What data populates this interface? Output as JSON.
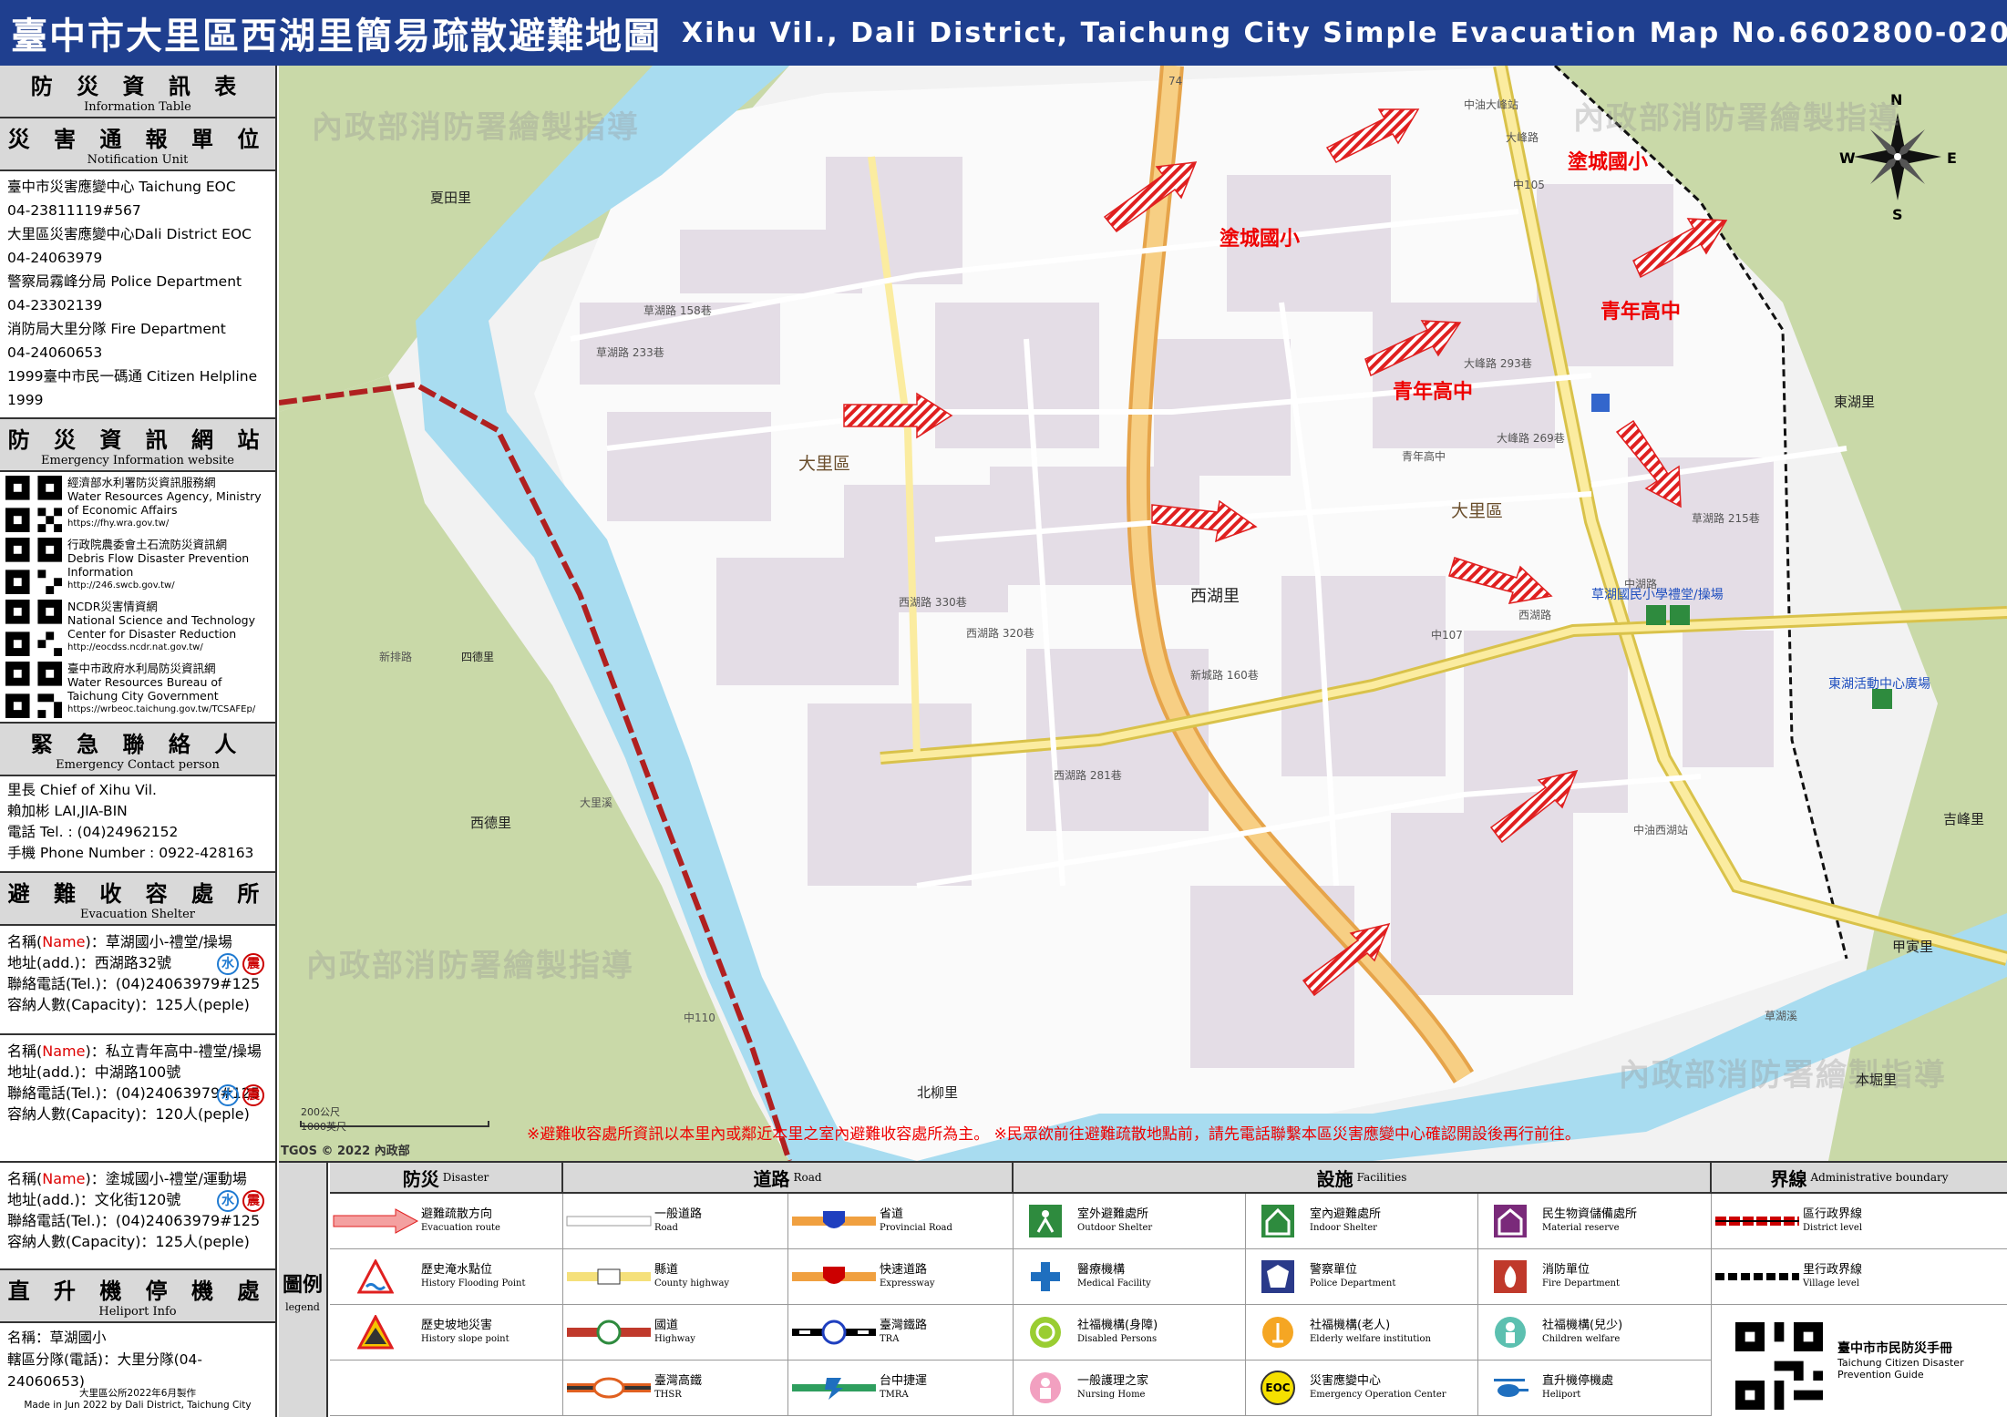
{
  "title": {
    "zh": "臺中市大里區西湖里簡易疏散避難地圖",
    "en": "Xihu Vil., Dali District, Taichung City Simple Evacuation Map No.6602800-020"
  },
  "info_table": {
    "zh": "防 災 資 訊 表",
    "en": "Information Table"
  },
  "notification": {
    "zh": "災 害 通 報 單 位",
    "en": "Notification Unit",
    "lines": [
      "臺中市災害應變中心 Taichung EOC",
      "04-23811119#567",
      "大里區災害應變中心Dali District EOC",
      "04-24063979",
      "警察局霧峰分局 Police Department",
      "04-23302139",
      "消防局大里分隊 Fire Department",
      "04-24060653",
      "1999臺中市民一碼通 Citizen Helpline",
      "1999"
    ]
  },
  "websites": {
    "zh": "防 災 資 訊 網 站",
    "en": "Emergency Information website",
    "items": [
      {
        "zh": "經濟部水利署防災資訊服務網",
        "en": "Water Resources Agency, Ministry of Economic Affairs",
        "url": "https://fhy.wra.gov.tw/"
      },
      {
        "zh": "行政院農委會土石流防災資訊網",
        "en": "Debris Flow Disaster Prevention Information",
        "url": "http://246.swcb.gov.tw/"
      },
      {
        "zh": "NCDR災害情資網",
        "en": "National Science and Technology Center for Disaster Reduction",
        "url": "http://eocdss.ncdr.nat.gov.tw/"
      },
      {
        "zh": "臺中市政府水利局防災資訊網",
        "en": "Water Resources Bureau of Taichung City Government",
        "url": "https://wrbeoc.taichung.gov.tw/TCSAFEp/"
      }
    ]
  },
  "contact": {
    "zh": "緊 急 聯 絡 人",
    "en": "Emergency Contact person",
    "lines": [
      "里長 Chief of Xihu Vil.",
      "賴加彬 LAI,JIA-BIN",
      "電話 Tel. : (04)24962152",
      "手機 Phone Number : 0922-428163"
    ]
  },
  "shelter": {
    "zh": "避 難 收 容 處 所",
    "en": "Evacuation Shelter",
    "name_prefix": "名稱(",
    "name_word": "Name",
    "name_suffix": ")：",
    "water_badge": "水",
    "quake_badge": "震",
    "items": [
      {
        "name": "草湖國小-禮堂/操場",
        "addr": "地址(add.)：西湖路32號",
        "tel": "聯絡電話(Tel.)：(04)24063979#125",
        "cap": "容納人數(Capacity)：125人(peple)"
      },
      {
        "name": "私立青年高中-禮堂/操場",
        "addr": "地址(add.)：中湖路100號",
        "tel": "聯絡電話(Tel.)：(04)24063979#125",
        "cap": "容納人數(Capacity)：120人(peple)"
      },
      {
        "name": "塗城國小-禮堂/運動場",
        "addr": "地址(add.)：文化街120號",
        "tel": "聯絡電話(Tel.)：(04)24063979#125",
        "cap": "容納人數(Capacity)：125人(peple)"
      }
    ]
  },
  "heliport": {
    "zh": "直 升 機 停 機 處",
    "en": "Heliport Info",
    "lines": [
      "名稱：草湖國小",
      "轄區分隊(電話)：大里分隊(04-24060653)"
    ]
  },
  "footer": {
    "zh": "大里區公所2022年6月製作",
    "en": "Made in Jun 2022 by Dali District, Taichung City"
  },
  "map": {
    "shelter_labels": [
      {
        "text": "塗城國小"
      },
      {
        "text": "塗城國小"
      },
      {
        "text": "青年高中"
      },
      {
        "text": "青年高中"
      }
    ],
    "area_labels": [
      "大里區",
      "大里區",
      "西湖里",
      "東湖里",
      "夏田里",
      "西德里",
      "四德里",
      "甲寅里",
      "北柳里",
      "本堀里",
      "吉峰里"
    ],
    "place_labels": [
      "草湖國民小學禮堂/操場",
      "東湖活動中心廣場"
    ],
    "watermark": "內政部消防署繪製指導",
    "road_labels": [
      "大峰路",
      "西湖路",
      "中湖路",
      "草湖溪",
      "大里溪",
      "新排路",
      "中105",
      "中107",
      "中110",
      "74",
      "西湖路 330巷",
      "西湖路 320巷",
      "大峰路 293巷",
      "大峰路 269巷",
      "草湖路 215巷",
      "西湖路 281巷",
      "新城路 160巷",
      "草湖路 158巷",
      "草湖路 233巷",
      "青年高中",
      "中油大峰站",
      "中油西湖站"
    ],
    "notice": "※避難收容處所資訊以本里內或鄰近本里之室內避難收容處所為主。 ※民眾欲前往避難疏散地點前，請先電話聯繫本區災害應變中心確認開設後再行前往。",
    "scale_m": "200公尺",
    "scale_ft": "1000英尺",
    "tgos": "TGOS © 2022 內政部",
    "compass": {
      "n": "N",
      "s": "S",
      "e": "E",
      "w": "W"
    }
  },
  "legend": {
    "title_zh": "圖例",
    "title_en": "legend",
    "disaster": {
      "zh": "防災",
      "en": "Disaster"
    },
    "road": {
      "zh": "道路",
      "en": "Road"
    },
    "facilities": {
      "zh": "設施",
      "en": "Facilities"
    },
    "boundary": {
      "zh": "界線",
      "en": "Administrative boundary"
    },
    "disaster_items": [
      {
        "zh": "避難疏散方向",
        "en": "Evacuation route"
      },
      {
        "zh": "歷史淹水點位",
        "en": "History Flooding Point"
      },
      {
        "zh": "歷史坡地災害",
        "en": "History slope point"
      }
    ],
    "road_items": [
      {
        "zh": "一般道路",
        "en": "Road"
      },
      {
        "zh": "省道",
        "en": "Provincial Road"
      },
      {
        "zh": "縣道",
        "en": "County highway"
      },
      {
        "zh": "快速道路",
        "en": "Expressway"
      },
      {
        "zh": "國道",
        "en": "Highway"
      },
      {
        "zh": "臺灣鐵路",
        "en": "TRA"
      },
      {
        "zh": "臺灣高鐵",
        "en": "THSR"
      },
      {
        "zh": "台中捷運",
        "en": "TMRA"
      }
    ],
    "facility_items": [
      {
        "zh": "室外避難處所",
        "en": "Outdoor Shelter"
      },
      {
        "zh": "室內避難處所",
        "en": "Indoor Shelter"
      },
      {
        "zh": "民生物資儲備處所",
        "en": "Material reserve"
      },
      {
        "zh": "醫療機構",
        "en": "Medical Facility"
      },
      {
        "zh": "警察單位",
        "en": "Police Department"
      },
      {
        "zh": "消防單位",
        "en": "Fire Department"
      },
      {
        "zh": "社福機構(身障)",
        "en": "Disabled Persons"
      },
      {
        "zh": "社福機構(老人)",
        "en": "Elderly welfare institution"
      },
      {
        "zh": "社福機構(兒少)",
        "en": "Children welfare"
      },
      {
        "zh": "一般護理之家",
        "en": "Nursing Home"
      },
      {
        "zh": "災害應變中心",
        "en": "Emergency Operation Center"
      },
      {
        "zh": "直升機停機處",
        "en": "Heliport"
      }
    ],
    "boundary_items": [
      {
        "zh": "區行政界線",
        "en": "District level"
      },
      {
        "zh": "里行政界線",
        "en": "Village level"
      }
    ],
    "eoc_text": "EOC",
    "guide": {
      "zh": "臺中市市民防災手冊",
      "en1": "Taichung Citizen Disaster",
      "en2": "Prevention Guide"
    }
  },
  "colors": {
    "title_bg": "#1f3f8f",
    "arrow": "#e02020",
    "river": "#a8dcf0",
    "green_zone": "#c9d9a8"
  }
}
